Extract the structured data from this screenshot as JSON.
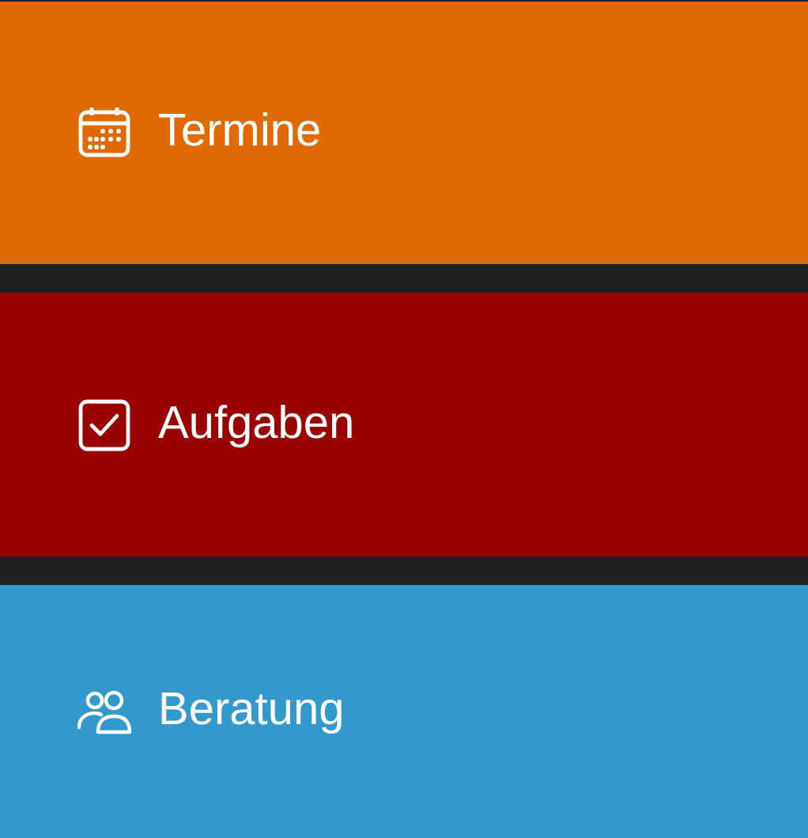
{
  "tiles": [
    {
      "label": "Termine",
      "kind": "calendar",
      "color": "#e06900"
    },
    {
      "label": "Aufgaben",
      "kind": "checkbox",
      "color": "#990000"
    },
    {
      "label": "Beratung",
      "kind": "people",
      "color": "#3398cc"
    }
  ]
}
